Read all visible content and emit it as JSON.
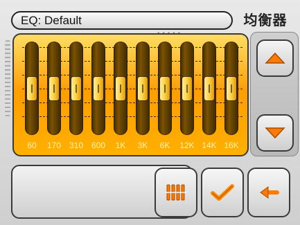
{
  "header": {
    "preset_label": "EQ: Default",
    "title": "均衡器"
  },
  "equalizer": {
    "bands": [
      {
        "freq": "60",
        "level": 0.0
      },
      {
        "freq": "170",
        "level": 0.0
      },
      {
        "freq": "310",
        "level": 0.0
      },
      {
        "freq": "600",
        "level": 0.0
      },
      {
        "freq": "1K",
        "level": 0.0
      },
      {
        "freq": "3K",
        "level": 0.0
      },
      {
        "freq": "6K",
        "level": 0.0
      },
      {
        "freq": "12K",
        "level": 0.0
      },
      {
        "freq": "14K",
        "level": 0.0
      },
      {
        "freq": "16K",
        "level": 0.0
      }
    ]
  },
  "icons": {
    "up": "arrow-up-icon",
    "down": "arrow-down-icon",
    "eq": "equalizer-bars-icon",
    "ok": "checkmark-icon",
    "back": "back-arrow-icon"
  },
  "colors": {
    "panel_top": "#ffd33d",
    "panel_mid": "#ff9d00",
    "accent_orange": "#ff8a00"
  }
}
